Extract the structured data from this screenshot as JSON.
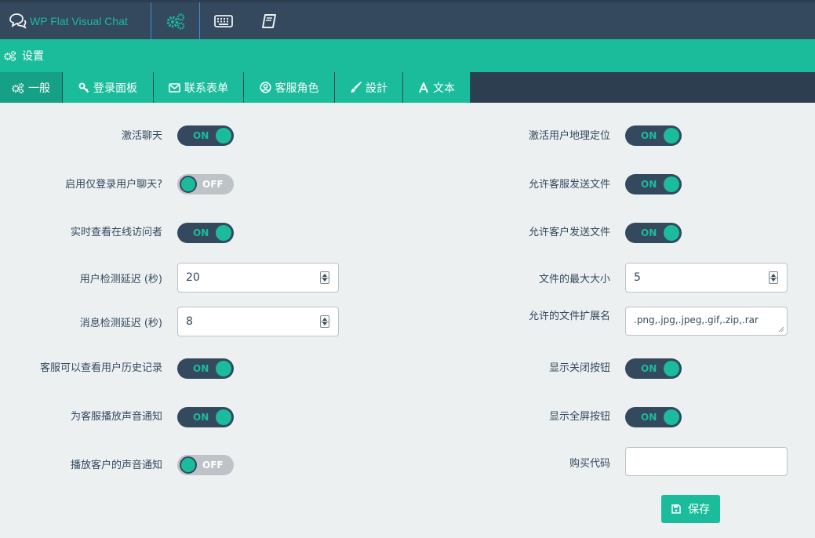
{
  "app": {
    "title": "WP Flat Visual Chat"
  },
  "header": {
    "title": "设置"
  },
  "tabs": [
    {
      "label": "一般",
      "icon": "gears-icon",
      "active": true
    },
    {
      "label": "登录面板",
      "icon": "key-icon"
    },
    {
      "label": "联系表单",
      "icon": "envelope-icon"
    },
    {
      "label": "客服角色",
      "icon": "user-circle-icon"
    },
    {
      "label": "設計",
      "icon": "brush-icon"
    },
    {
      "label": "文本",
      "icon": "font-icon"
    }
  ],
  "toggle_text": {
    "on": "ON",
    "off": "OFF"
  },
  "left_settings": [
    {
      "label": "激活聊天",
      "state": "on"
    },
    {
      "label": "启用仅登录用户聊天?",
      "state": "off"
    },
    {
      "label": "实时查看在线访问者",
      "state": "on"
    },
    {
      "label": "用户检测延迟 (秒)",
      "value": "20"
    },
    {
      "label": "消息检测延迟 (秒)",
      "value": "8"
    },
    {
      "label": "客服可以查看用户历史记录",
      "state": "on"
    },
    {
      "label": "为客服播放声音通知",
      "state": "on"
    },
    {
      "label": "播放客户的声音通知",
      "state": "off"
    }
  ],
  "right_settings": [
    {
      "label": "激活用户地理定位",
      "state": "on"
    },
    {
      "label": "允许客服发送文件",
      "state": "on"
    },
    {
      "label": "允许客户发送文件",
      "state": "on"
    },
    {
      "label": "文件的最大大小",
      "value": "5"
    },
    {
      "label": "允许的文件扩展名",
      "value": ".png,.jpg,.jpeg,.gif,.zip,.rar"
    },
    {
      "label": "显示关闭按钮",
      "state": "on"
    },
    {
      "label": "显示全屏按钮",
      "state": "on"
    },
    {
      "label": "购买代码",
      "value": ""
    }
  ],
  "save_button": {
    "label": "保存"
  },
  "colors": {
    "accent": "#1abc9c",
    "dark": "#34495e",
    "darker": "#2c3e50",
    "background": "#ecf0f1"
  }
}
